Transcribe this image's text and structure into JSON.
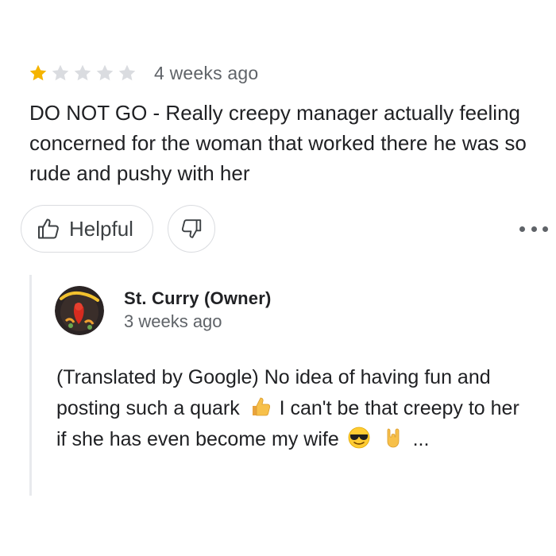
{
  "review": {
    "rating": 1,
    "rating_max": 5,
    "date": "4 weeks ago",
    "text": "DO NOT GO - Really creepy manager actually feeling concerned for the woman that worked there he was so rude and pushy with her",
    "star_filled_color": "#fbbc04",
    "star_empty_color": "#dadce0"
  },
  "actions": {
    "helpful_label": "Helpful",
    "helpful_icon": "thumbs-up-outline-icon",
    "unhelpful_icon": "thumbs-down-outline-icon",
    "more_icon": "more-horizontal-icon"
  },
  "owner_reply": {
    "name": "St. Curry (Owner)",
    "avatar_icon": "restaurant-logo-avatar",
    "date": "3 weeks ago",
    "text_part1": "(Translated by Google) No idea of having fun and posting such a quark",
    "text_part2": "I can't be that creepy to her if she has even become my wife",
    "ellipsis": "...",
    "emojis": [
      "thumbs-up-emoji",
      "sunglasses-face-emoji",
      "rock-on-hand-emoji"
    ]
  }
}
